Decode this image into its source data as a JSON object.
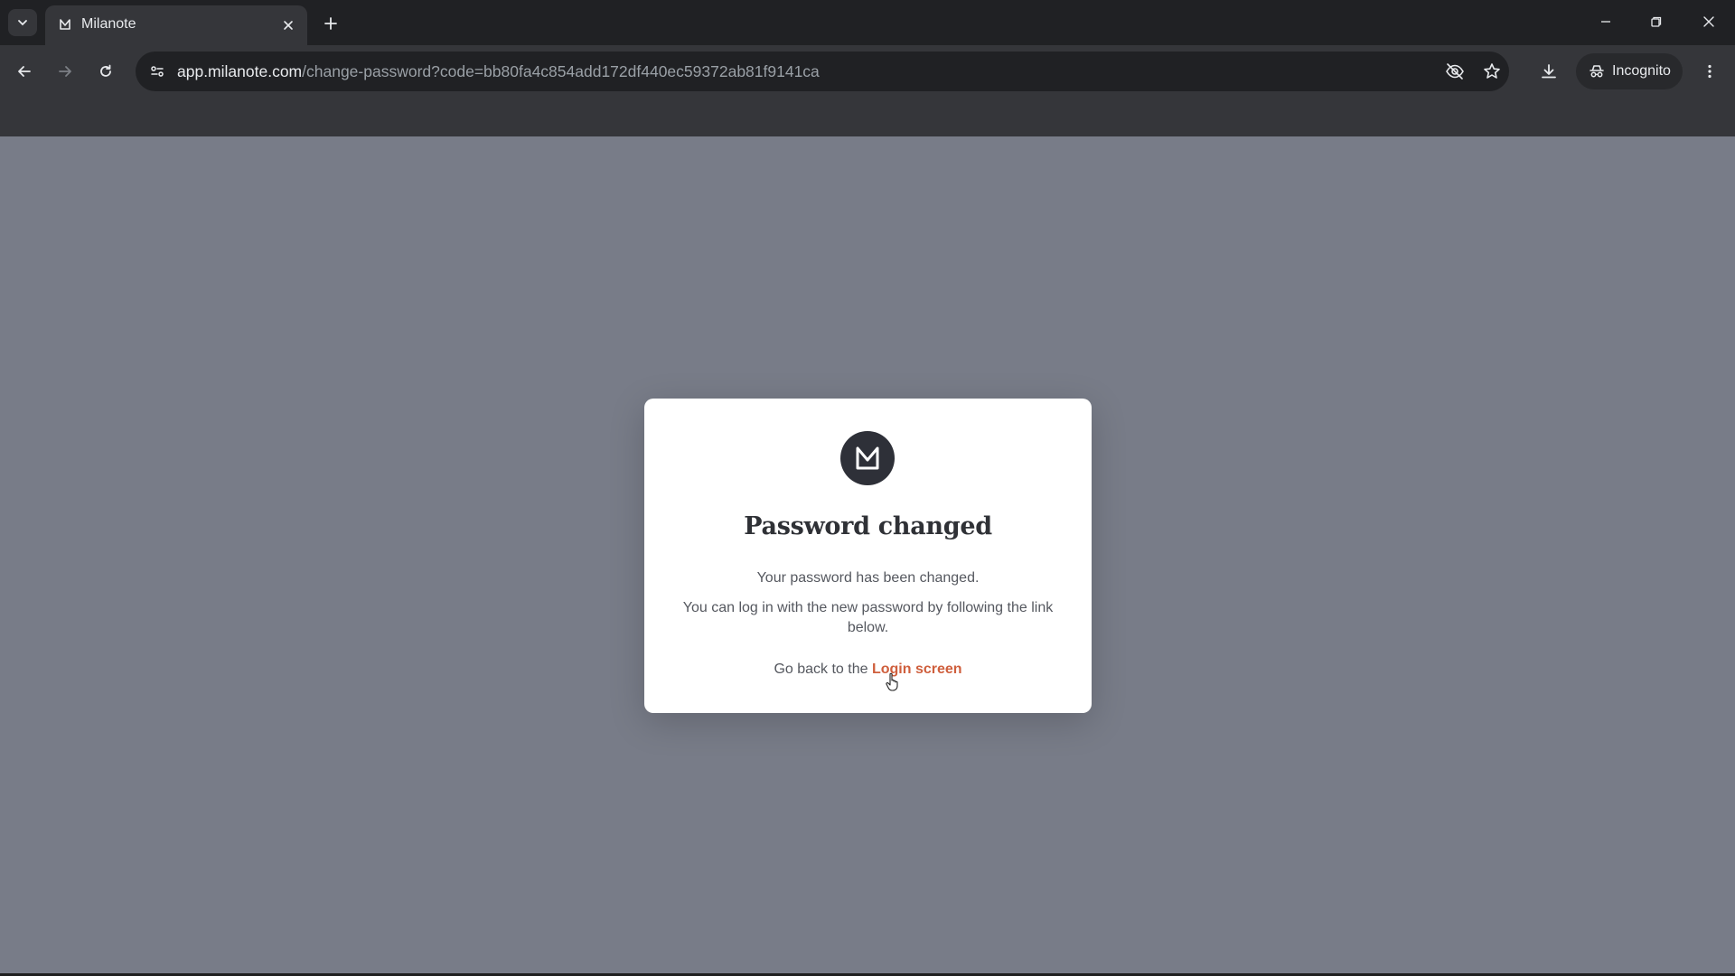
{
  "browser": {
    "tab": {
      "title": "Milanote"
    },
    "url": {
      "host": "app.milanote.com",
      "path": "/change-password?code=bb80fa4c854add172df440ec59372ab81f9141ca"
    },
    "incognito_label": "Incognito",
    "icons": {
      "tab_search": "chevron-down-icon",
      "tab_favicon": "milanote-logo-icon",
      "tab_close": "close-icon",
      "new_tab": "plus-icon",
      "back": "arrow-left-icon",
      "forward": "arrow-right-icon",
      "reload": "reload-icon",
      "site_info": "tune-icon",
      "tracking": "eye-off-icon",
      "bookmark": "star-icon",
      "download": "download-icon",
      "incognito": "incognito-icon",
      "menu": "kebab-menu-icon",
      "minimize": "minimize-icon",
      "restore": "restore-icon",
      "close_window": "close-icon"
    }
  },
  "page": {
    "background_color": "#787c88",
    "modal": {
      "title": "Password changed",
      "message_1": "Your password has been changed.",
      "message_2": "You can log in with the new password by following the link below.",
      "go_back_prefix": "Go back to the ",
      "login_link": "Login screen",
      "link_color": "#cf5f3d"
    }
  }
}
